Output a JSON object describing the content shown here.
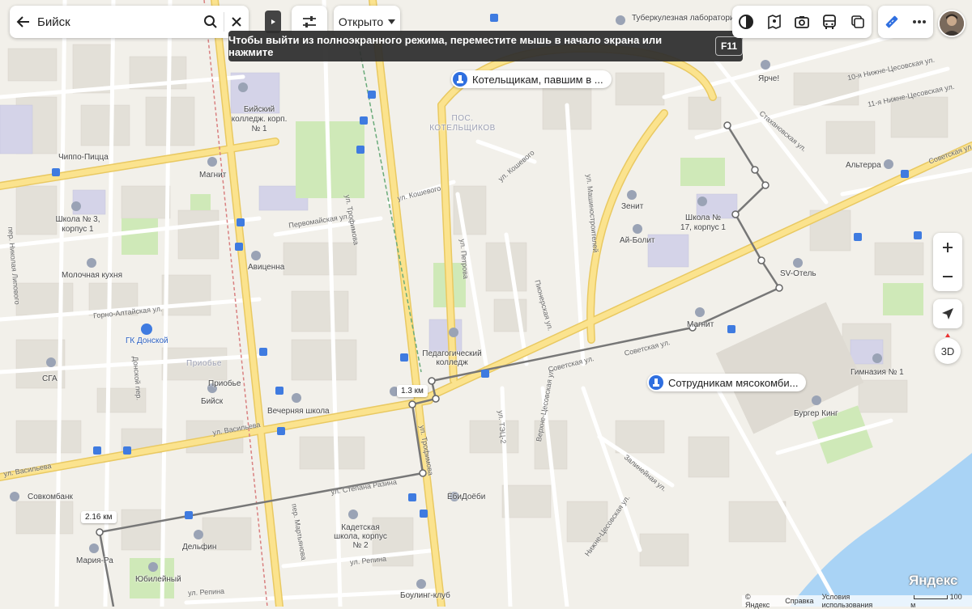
{
  "search": {
    "query": "Бийск"
  },
  "open_filter": {
    "label": "Открыто"
  },
  "fullscreen_banner": {
    "text": "Чтобы выйти из полноэкранного режима, переместите мышь в начало экрана или нажмите",
    "key": "F11"
  },
  "map_pois": {
    "monument_1": "Котельщикам, павшим в ...",
    "monument_2": "Сотрудникам мясокомби..."
  },
  "ruler": {
    "label_1": "1.3 км",
    "label_2": "2.16 км"
  },
  "controls": {
    "compass_label": "3D"
  },
  "branding": {
    "logo": "Яндекс"
  },
  "footer": {
    "copyright": "© Яндекс",
    "help": "Справка",
    "terms": "Условия использования",
    "scale": "100 м"
  },
  "places": {
    "tb_lab": "Туберкулезная лаборатория",
    "yarche": "Ярче!",
    "college_1": "Бийский колледж. корп. № 1",
    "district_kotel": "ПОС. КОТЕЛЬЩИКОВ",
    "chippo": "Чиппо-Пицца",
    "magnit_1": "Магнит",
    "school3": "Школа № 3, корпус 1",
    "molochnaya": "Молочная кухня",
    "avicenna": "Авиценна",
    "zenit": "Зенит",
    "ai_bolit": "Ай-Болит",
    "school17": "Школа № 17, корпус 1",
    "alterra": "Альтерра",
    "sv_hotel": "SV-Отель",
    "magnit_2": "Магнит",
    "ped_college": "Педагогический колледж",
    "gk_donskoy": "ГК Донской",
    "priobye": "Приобье",
    "priobye_2": "Приобье",
    "sga": "СГА",
    "biysk": "Бийск",
    "evening_school": "Вечерняя школа",
    "gymnasium": "Гимназия № 1",
    "burger_king": "Бургер Кинг",
    "sovcombank": "Совкомбанк",
    "edidoebi": "ЁбиДоёби",
    "cadet": "Кадетская школа, корпус № 2",
    "delfin": "Дельфин",
    "maria_ra": "Мария-Ра",
    "yubileyny": "Юбилейный",
    "bowling": "Боулинг-клуб"
  },
  "streets": {
    "trofimova_1": "ул. Трофимова",
    "trofimova_2": "ул. Трофимова",
    "koshevogo_1": "ул. Кошевого",
    "koshevogo_2": "ул. Кошевого",
    "pervomayskaya": "Первомайская ул.",
    "mashinostroiteley": "ул. Машиностроителей",
    "petrova": "ул. Петрова",
    "pionerskaya": "Пионерская ул.",
    "stakhanovskaya": "Стахановская ул.",
    "sovetskaya_1": "Советская ул.",
    "sovetskaya_2": "Советская ул.",
    "sovetskaya_3": "Советская ул.",
    "vasilyeva_1": "ул. Васильева",
    "vasilyeva_2": "ул. Васильева",
    "gorno_altayskaya": "Горно-Алтайская ул.",
    "donskoy": "Донской пер.",
    "lipovy": "пер. Николая Липового",
    "stepana_razina": "ул. Степана Разина",
    "martyanova": "пер. Мартьянова",
    "repina_1": "ул. Репина",
    "repina_2": "ул. Репина",
    "tets2": "ул. ТЭЦ-2",
    "verkhne_tses": "Верхне-Цесовская ул.",
    "nizhne_tses_1": "10-я Нижне-Цесовская ул.",
    "nizhne_tses_2": "11-я Нижне-Цесовская ул.",
    "nizhne_tses_3": "Нижне-Цесовская ул.",
    "zalinejnaya": "Залинейная ул."
  },
  "colors": {
    "route": "#777777",
    "water": "#a9d3f5",
    "park": "#cfe9b8",
    "major_road": "#fbe38e",
    "accent_blue": "#2f6fe0"
  }
}
